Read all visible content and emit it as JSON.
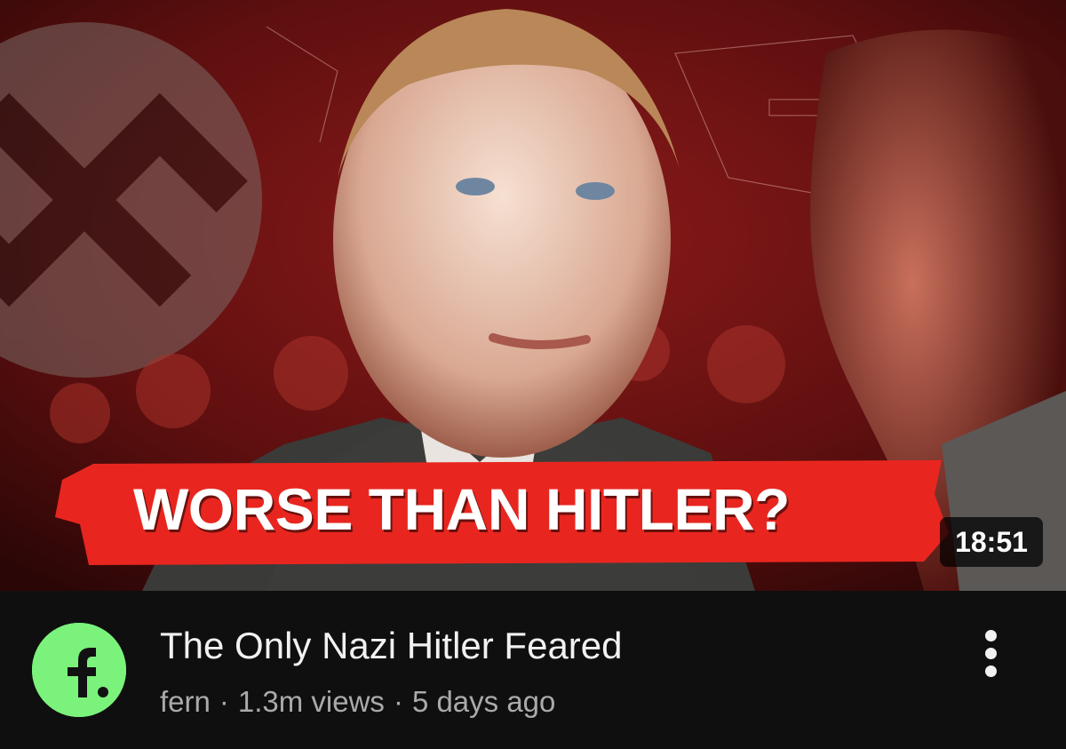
{
  "thumbnail": {
    "headline": "WORSE THAN HITLER?",
    "duration": "18:51",
    "banner_color": "#e8261f",
    "background_color": "#6b1010"
  },
  "video": {
    "title": "The Only Nazi Hitler Feared",
    "channel": "fern",
    "views": "1.3m views",
    "age": "5 days ago",
    "separator": "·"
  },
  "channel_avatar": {
    "letter": "f.",
    "color": "#7bf27b"
  },
  "icons": {
    "more": "more-vert-icon"
  }
}
